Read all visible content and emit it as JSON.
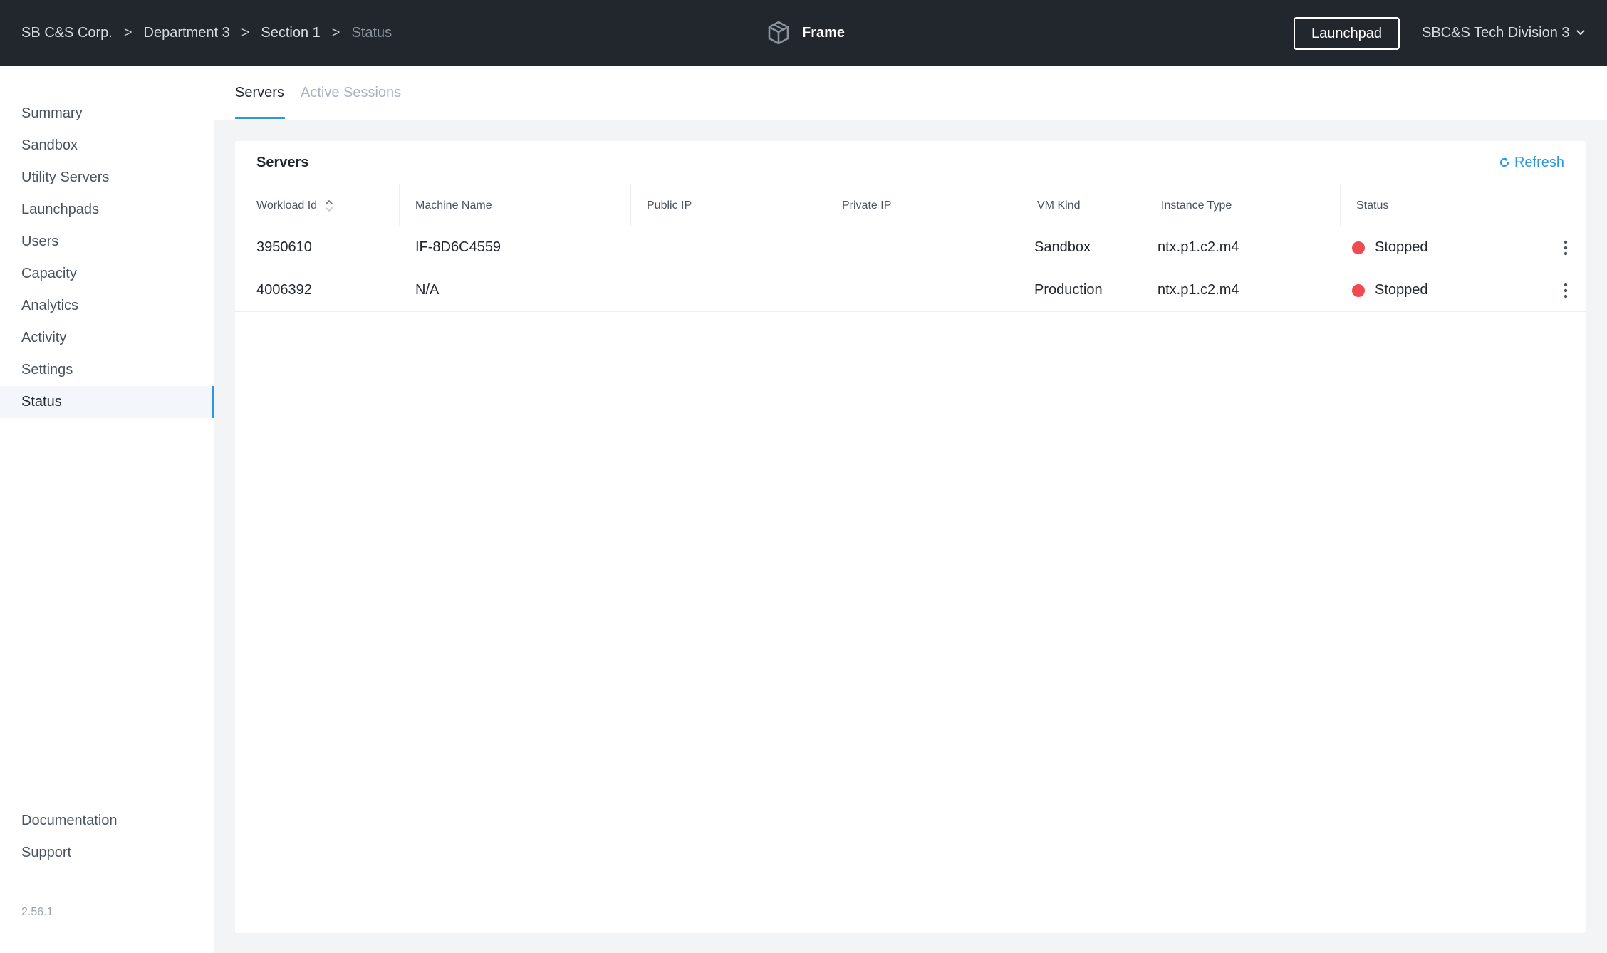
{
  "header": {
    "breadcrumb": [
      "SB C&S Corp.",
      "Department 3",
      "Section 1",
      "Status"
    ],
    "breadcrumb_separator": ">",
    "brand_name": "Frame",
    "launchpad_label": "Launchpad",
    "account_label": "SBC&S Tech Division 3"
  },
  "sidebar": {
    "items": [
      {
        "label": "Summary"
      },
      {
        "label": "Sandbox"
      },
      {
        "label": "Utility Servers"
      },
      {
        "label": "Launchpads"
      },
      {
        "label": "Users"
      },
      {
        "label": "Capacity"
      },
      {
        "label": "Analytics"
      },
      {
        "label": "Activity"
      },
      {
        "label": "Settings"
      },
      {
        "label": "Status",
        "active": true
      }
    ],
    "footer_items": [
      {
        "label": "Documentation"
      },
      {
        "label": "Support"
      }
    ],
    "version": "2.56.1"
  },
  "tabs": [
    {
      "label": "Servers",
      "active": true
    },
    {
      "label": "Active Sessions",
      "active": false
    }
  ],
  "servers_card": {
    "title": "Servers",
    "refresh_label": "Refresh",
    "columns": [
      "Workload Id",
      "Machine Name",
      "Public IP",
      "Private IP",
      "VM Kind",
      "Instance Type",
      "Status"
    ],
    "rows": [
      {
        "workload_id": "3950610",
        "machine_name": "IF-8D6C4559",
        "public_ip": "",
        "private_ip": "",
        "vm_kind": "Sandbox",
        "instance_type": "ntx.p1.c2.m4",
        "status": "Stopped"
      },
      {
        "workload_id": "4006392",
        "machine_name": "N/A",
        "public_ip": "",
        "private_ip": "",
        "vm_kind": "Production",
        "instance_type": "ntx.p1.c2.m4",
        "status": "Stopped"
      }
    ]
  },
  "colors": {
    "header_bg": "#22272e",
    "accent": "#2d97e6",
    "status_stopped": "#ef4b51",
    "main_bg": "#f2f4f6"
  },
  "icons": {
    "brand": "cube-icon",
    "account_dropdown": "chevron-down-icon",
    "refresh": "refresh-icon",
    "sort": "sort-icon",
    "row_menu": "kebab-menu-icon"
  }
}
